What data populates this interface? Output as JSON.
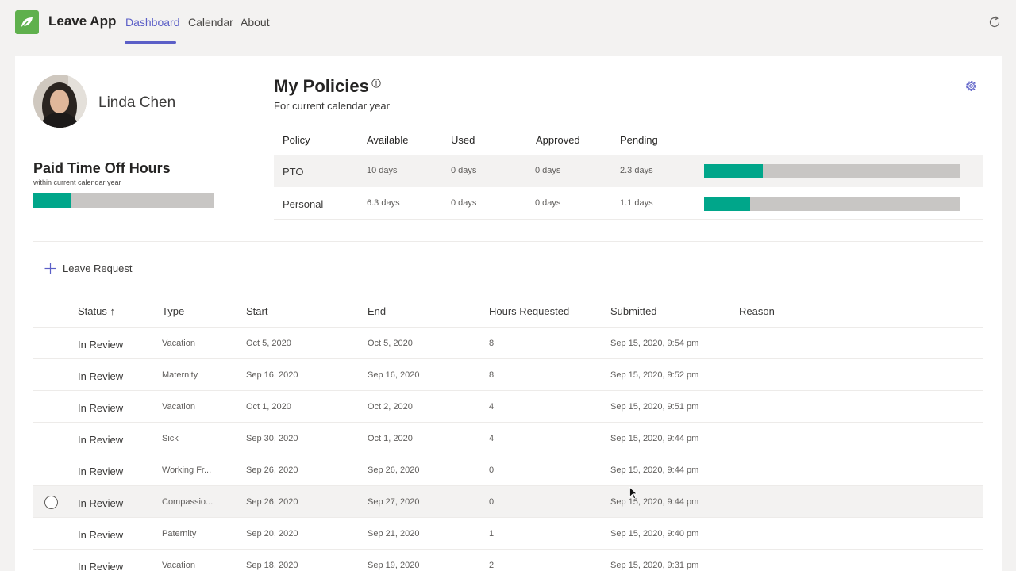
{
  "app": {
    "title": "Leave App",
    "accent": "#5b5fc7",
    "logo_color": "#5fb04d"
  },
  "nav": {
    "tabs": [
      {
        "label": "Dashboard"
      },
      {
        "label": "Calendar"
      },
      {
        "label": "About"
      }
    ],
    "active": "Dashboard"
  },
  "user": {
    "name": "Linda Chen"
  },
  "pto": {
    "title": "Paid Time Off Hours",
    "subtitle": "within current calendar year",
    "fill_fraction": 0.21
  },
  "policies": {
    "title": "My Policies",
    "subtitle": "For current calendar year",
    "columns": [
      "Policy",
      "Available",
      "Used",
      "Approved",
      "Pending"
    ],
    "rows": [
      {
        "policy": "PTO",
        "available": "10 days",
        "used": "0 days",
        "approved": "0 days",
        "pending": "2.3 days",
        "fill_fraction": 0.23
      },
      {
        "policy": "Personal",
        "available": "6.3 days",
        "used": "0 days",
        "approved": "0 days",
        "pending": "1.1 days",
        "fill_fraction": 0.18
      }
    ]
  },
  "requests": {
    "add_label": "Leave Request",
    "columns": [
      "Status ↑",
      "Type",
      "Start",
      "End",
      "Hours Requested",
      "Submitted",
      "Reason"
    ],
    "rows": [
      {
        "status": "In Review",
        "type": "Vacation",
        "start": "Oct 5, 2020",
        "end": "Oct 5, 2020",
        "hours": "8",
        "submitted": "Sep 15, 2020, 9:54 pm",
        "reason": ""
      },
      {
        "status": "In Review",
        "type": "Maternity",
        "start": "Sep 16, 2020",
        "end": "Sep 16, 2020",
        "hours": "8",
        "submitted": "Sep 15, 2020, 9:52 pm",
        "reason": ""
      },
      {
        "status": "In Review",
        "type": "Vacation",
        "start": "Oct 1, 2020",
        "end": "Oct 2, 2020",
        "hours": "4",
        "submitted": "Sep 15, 2020, 9:51 pm",
        "reason": ""
      },
      {
        "status": "In Review",
        "type": "Sick",
        "start": "Sep 30, 2020",
        "end": "Oct 1, 2020",
        "hours": "4",
        "submitted": "Sep 15, 2020, 9:44 pm",
        "reason": ""
      },
      {
        "status": "In Review",
        "type": "Working Fr...",
        "start": "Sep 26, 2020",
        "end": "Sep 26, 2020",
        "hours": "0",
        "submitted": "Sep 15, 2020, 9:44 pm",
        "reason": ""
      },
      {
        "status": "In Review",
        "type": "Compassio...",
        "start": "Sep 26, 2020",
        "end": "Sep 27, 2020",
        "hours": "0",
        "submitted": "Sep 15, 2020, 9:44 pm",
        "reason": ""
      },
      {
        "status": "In Review",
        "type": "Paternity",
        "start": "Sep 20, 2020",
        "end": "Sep 21, 2020",
        "hours": "1",
        "submitted": "Sep 15, 2020, 9:40 pm",
        "reason": ""
      },
      {
        "status": "In Review",
        "type": "Vacation",
        "start": "Sep 18, 2020",
        "end": "Sep 19, 2020",
        "hours": "2",
        "submitted": "Sep 15, 2020, 9:31 pm",
        "reason": ""
      }
    ]
  }
}
